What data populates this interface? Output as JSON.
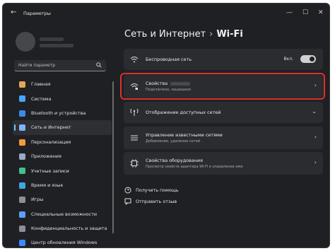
{
  "window": {
    "title": "Параметры"
  },
  "search": {
    "placeholder": "Найти параметр"
  },
  "breadcrumb": {
    "parent": "Сеть и Интернет",
    "separator": "›",
    "current": "Wi-Fi"
  },
  "sidebar": {
    "items": [
      {
        "label": "Главная",
        "icon": "home-icon",
        "color": "#e8a55a"
      },
      {
        "label": "Система",
        "icon": "system-icon",
        "color": "#4aa3ff"
      },
      {
        "label": "Bluetooth и устройства",
        "icon": "bluetooth-icon",
        "color": "#3a8be6"
      },
      {
        "label": "Сеть и Интернет",
        "icon": "network-icon",
        "color": "#7fb3ff",
        "active": true
      },
      {
        "label": "Персонализация",
        "icon": "personalization-icon",
        "color": "#f39b3b"
      },
      {
        "label": "Приложения",
        "icon": "apps-icon",
        "color": "#9aa8c7"
      },
      {
        "label": "Учетные записи",
        "icon": "accounts-icon",
        "color": "#44c08a"
      },
      {
        "label": "Время и язык",
        "icon": "time-language-icon",
        "color": "#3fa7e0"
      },
      {
        "label": "Игры",
        "icon": "gaming-icon",
        "color": "#8b8f99"
      },
      {
        "label": "Специальные возможности",
        "icon": "accessibility-icon",
        "color": "#5aa0ff"
      },
      {
        "label": "Конфиденциальность и защита",
        "icon": "privacy-icon",
        "color": "#8a8f99"
      },
      {
        "label": "Центр обновления Windows",
        "icon": "update-icon",
        "color": "#3d8bff"
      }
    ]
  },
  "main": {
    "wifi": {
      "label": "Беспроводная сеть",
      "toggle_label": "Вкл.",
      "toggle_on": true
    },
    "properties": {
      "label": "Свойства",
      "sub": "Подключено, защищено"
    },
    "available": {
      "label": "Отображение доступных сетей"
    },
    "known": {
      "label": "Управление известными сетями",
      "sub": "Добавление, удаление сетей"
    },
    "hardware": {
      "label": "Свойства оборудования",
      "sub": "Просмотр свойств адаптера Wi-Fi и управление ими"
    }
  },
  "footer": {
    "help": "Получить помощь",
    "feedback": "Отправить отзыв"
  },
  "colors": {
    "accent": "#60cdff",
    "highlight": "#e2302d",
    "background": "#1f2023",
    "card": "#2b2c30"
  }
}
